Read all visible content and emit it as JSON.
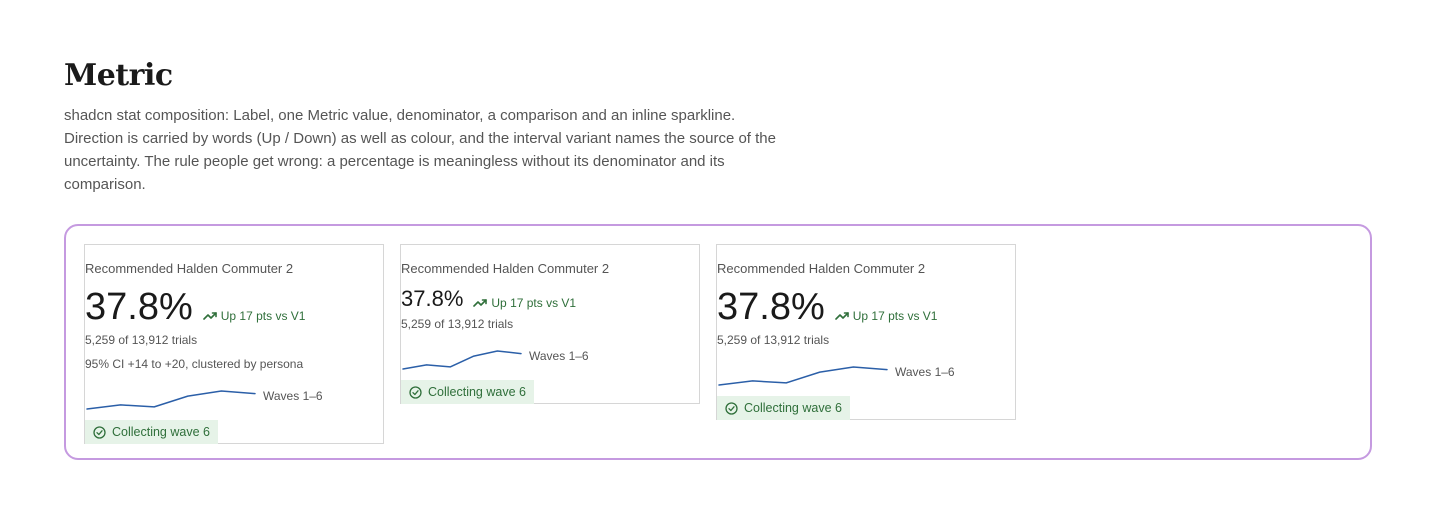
{
  "header": {
    "title": "Metric",
    "description": "shadcn stat composition: Label, one Metric value, denominator, a comparison and an inline sparkline. Direction is carried by words (Up / Down) as well as colour, and the interval variant names the source of the uncertainty. The rule people get wrong: a percentage is meaningless without its denominator and its comparison."
  },
  "colors": {
    "frame_border": "#c59ae0",
    "positive_text": "#2f6f3a",
    "pill_background": "#e6f3e8",
    "sparkline": "#2b5fa8"
  },
  "cards": [
    {
      "label": "Recommended Halden Commuter 2",
      "value": "37.8%",
      "comparison": "Up 17 pts vs V1",
      "comparison_icon": "trending-up-icon",
      "denominator": "5,259 of 13,912 trials",
      "interval": "95% CI +14 to +20, clustered by persona",
      "sparkline_caption": "Waves 1–6",
      "sparkline_values": [
        20.5,
        24.5,
        22.5,
        33,
        38,
        35.5
      ],
      "status": "Collecting wave 6",
      "status_icon": "check-circle-icon"
    },
    {
      "label": "Recommended Halden Commuter 2",
      "value": "37.8%",
      "comparison": "Up 17 pts vs V1",
      "comparison_icon": "trending-up-icon",
      "denominator": "5,259 of 13,912 trials",
      "sparkline_caption": "Waves 1–6",
      "sparkline_values": [
        20.5,
        24.5,
        22.5,
        33,
        38,
        35.5
      ],
      "status": "Collecting wave 6",
      "status_icon": "check-circle-icon"
    },
    {
      "label": "Recommended Halden Commuter 2",
      "value": "37.8%",
      "comparison": "Up 17 pts vs V1",
      "comparison_icon": "trending-up-icon",
      "denominator": "5,259 of 13,912 trials",
      "sparkline_caption": "Waves 1–6",
      "sparkline_values": [
        20.5,
        24.5,
        22.5,
        33,
        38,
        35.5
      ],
      "status": "Collecting wave 6",
      "status_icon": "check-circle-icon"
    }
  ]
}
